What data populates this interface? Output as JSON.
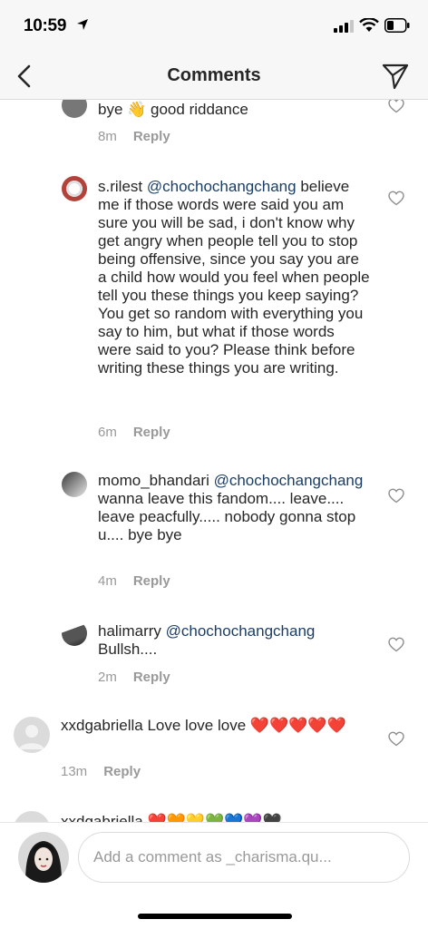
{
  "status_bar": {
    "time": "10:59"
  },
  "nav": {
    "title": "Comments"
  },
  "comments": [
    {
      "text": "bye 👋 good riddance",
      "time": "8m",
      "reply": "Reply"
    },
    {
      "user": "s.rilest",
      "mention": "@chochochangchang",
      "text": "believe me if those words were said you am sure you will be sad, i don't know why get angry when people tell you to stop being offensive, since you say you are a child how would you feel when people tell you these things you keep saying? You get so random with everything you say to him, but what if those words were said to you? Please think before writing these things you are writing.",
      "time": "6m",
      "reply": "Reply"
    },
    {
      "user": "momo_bhandari",
      "mention": "@chochochangchang",
      "text": "wanna leave this fandom.... leave.... leave peacfully..... nobody gonna stop u.... bye bye",
      "time": "4m",
      "reply": "Reply"
    },
    {
      "user": "halimarry",
      "mention": "@chochochangchang",
      "text": "Bullsh....",
      "time": "2m",
      "reply": "Reply"
    },
    {
      "user": "xxdgabriella",
      "text": "Love love love ❤️❤️❤️❤️❤️",
      "time": "13m",
      "reply": "Reply"
    },
    {
      "user": "xxdgabriella",
      "text": "❤️🧡💛💚💙💜🖤"
    }
  ],
  "composer": {
    "placeholder": "Add a comment as _charisma.qu..."
  },
  "colors": {
    "mention": "#1b3e66",
    "meta": "#999999",
    "heart_outline": "#8e8e8e"
  }
}
